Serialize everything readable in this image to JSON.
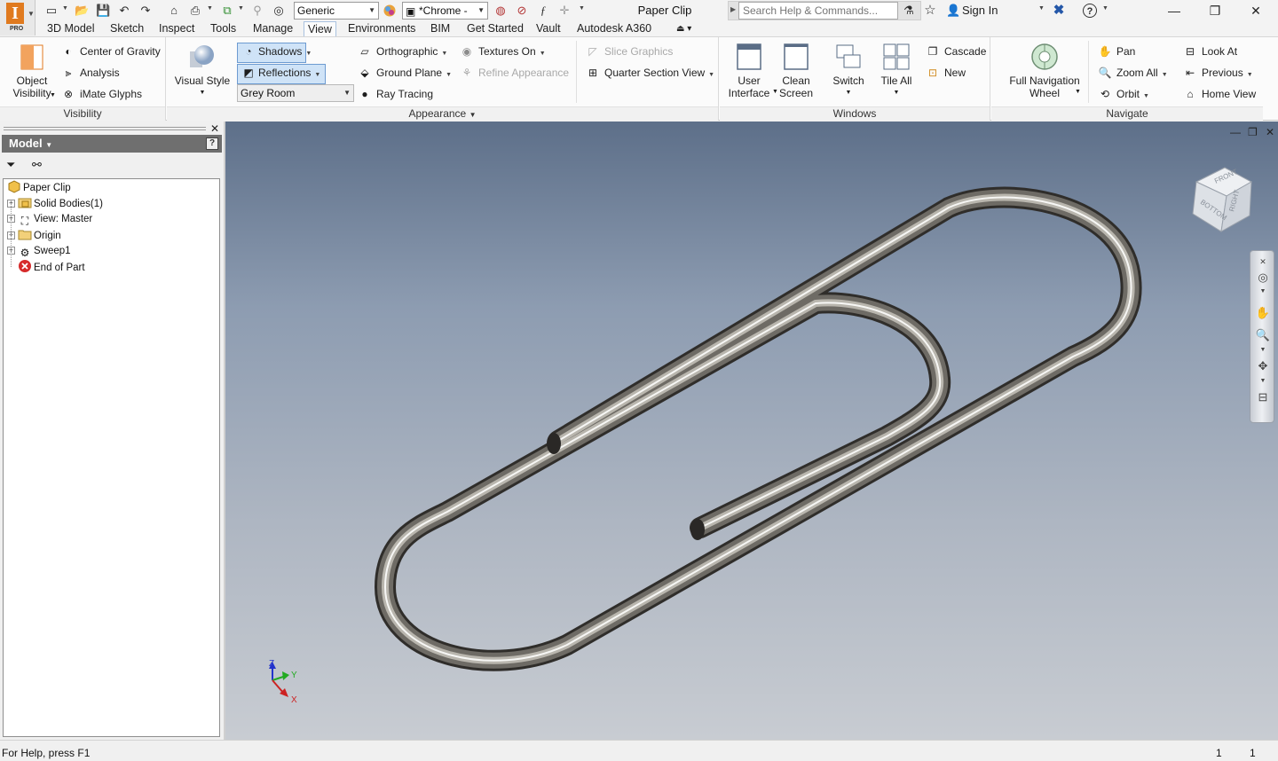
{
  "app": {
    "logo_label": "PRO",
    "logo_letter": "I",
    "document_title": "Paper Clip"
  },
  "quick_access": {
    "material": "Generic",
    "appearance": "*Chrome -",
    "search_placeholder": "Search Help & Commands...",
    "sign_in": "Sign In",
    "help": "?"
  },
  "tabs": [
    {
      "label": "3D Model"
    },
    {
      "label": "Sketch"
    },
    {
      "label": "Inspect"
    },
    {
      "label": "Tools"
    },
    {
      "label": "Manage"
    },
    {
      "label": "View",
      "active": true
    },
    {
      "label": "Environments"
    },
    {
      "label": "BIM"
    },
    {
      "label": "Get Started"
    },
    {
      "label": "Vault"
    },
    {
      "label": "Autodesk A360"
    }
  ],
  "ribbon": {
    "visibility": {
      "title": "Visibility",
      "object_visibility": "Object Visibility",
      "object_visibility_line1": "Object",
      "object_visibility_line2": "Visibility",
      "center_of_gravity": "Center of Gravity",
      "analysis": "Analysis",
      "imate_glyphs": "iMate Glyphs"
    },
    "appearance": {
      "title": "Appearance",
      "visual_style": "Visual Style",
      "shadows": "Shadows",
      "reflections": "Reflections",
      "lighting_style": "Grey Room",
      "orthographic": "Orthographic",
      "ground_plane": "Ground Plane",
      "ray_tracing": "Ray Tracing",
      "textures_on": "Textures On",
      "refine_appearance": "Refine Appearance",
      "slice_graphics": "Slice Graphics",
      "quarter_section_view": "Quarter Section View"
    },
    "windows": {
      "title": "Windows",
      "user_interface_1": "User",
      "user_interface_2": "Interface",
      "clean_screen_1": "Clean",
      "clean_screen_2": "Screen",
      "switch": "Switch",
      "tile_all": "Tile All",
      "cascade": "Cascade",
      "new": "New"
    },
    "navigate": {
      "title": "Navigate",
      "full_nav_wheel_1": "Full Navigation",
      "full_nav_wheel_2": "Wheel",
      "pan": "Pan",
      "zoom_all": "Zoom All",
      "orbit": "Orbit",
      "look_at": "Look At",
      "previous": "Previous",
      "home_view": "Home View"
    }
  },
  "browser": {
    "title": "Model",
    "tree": [
      {
        "label": "Paper Clip",
        "icon": "part-icon",
        "expandable": false
      },
      {
        "label": "Solid Bodies(1)",
        "icon": "solid-bodies-folder-icon",
        "expandable": true
      },
      {
        "label": "View: Master",
        "icon": "view-rep-icon",
        "expandable": true
      },
      {
        "label": "Origin",
        "icon": "folder-icon",
        "expandable": true
      },
      {
        "label": "Sweep1",
        "icon": "sweep-feature-icon",
        "expandable": true
      },
      {
        "label": "End of Part",
        "icon": "end-of-part-icon",
        "expandable": false
      }
    ]
  },
  "viewport": {
    "viewcube_faces": [
      "FRONT",
      "RIGHT",
      "BOTTOM"
    ],
    "triad_labels": {
      "x": "X",
      "y": "Y",
      "z": "Z"
    }
  },
  "status": {
    "help_text": "For Help, press F1",
    "count_1": "1",
    "count_2": "1"
  }
}
